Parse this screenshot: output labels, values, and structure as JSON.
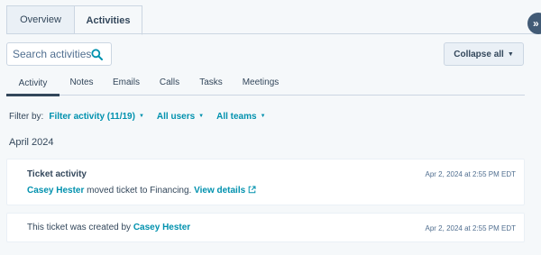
{
  "top_tabs": [
    {
      "label": "Overview"
    },
    {
      "label": "Activities"
    }
  ],
  "search": {
    "placeholder": "Search activities"
  },
  "collapse": {
    "label": "Collapse all"
  },
  "sub_tabs": [
    {
      "label": "Activity"
    },
    {
      "label": "Notes"
    },
    {
      "label": "Emails"
    },
    {
      "label": "Calls"
    },
    {
      "label": "Tasks"
    },
    {
      "label": "Meetings"
    }
  ],
  "filters": {
    "label": "Filter by:",
    "activity": "Filter activity (11/19)",
    "users": "All users",
    "teams": "All teams"
  },
  "month": "April 2024",
  "cards": [
    {
      "title": "Ticket activity",
      "timestamp": "Apr 2, 2024 at 2:55 PM EDT",
      "user": "Casey Hester",
      "text": " moved ticket to Financing. ",
      "link": "View details"
    },
    {
      "timestamp": "Apr 2, 2024 at 2:55 PM EDT",
      "text": "This ticket was created by ",
      "user": "Casey Hester"
    }
  ],
  "colors": {
    "accent": "#0091ae",
    "text": "#33475b",
    "background": "#f5f8fa"
  },
  "icons": {
    "search": "search-icon",
    "expand": "double-chevron-right-icon",
    "external": "external-link-icon"
  }
}
